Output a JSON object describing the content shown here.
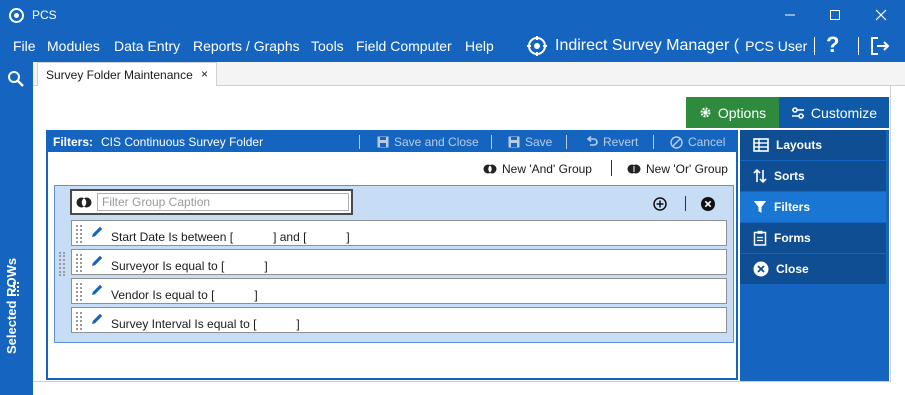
{
  "window": {
    "title": "PCS"
  },
  "menu": {
    "items": [
      "File",
      "Modules",
      "Data Entry",
      "Reports / Graphs",
      "Tools",
      "Field Computer",
      "Help"
    ],
    "app_title": "Indirect Survey Manager (",
    "user": "PCS User",
    "help_icon": "?"
  },
  "sidebar": {
    "label": "Selected ROWs"
  },
  "tabs": [
    {
      "label": "Survey Folder Maintenance",
      "close": "×"
    }
  ],
  "toolbar": {
    "options_label": "Options",
    "customize_label": "Customize"
  },
  "filters_panel": {
    "label": "Filters:",
    "caption": "CIS Continuous Survey Folder",
    "save_close_label": "Save and Close",
    "save_label": "Save",
    "revert_label": "Revert",
    "cancel_label": "Cancel",
    "new_and_group": "New 'And' Group",
    "new_or_group": "New 'Or' Group",
    "group_caption_placeholder": "Filter Group Caption",
    "rows": [
      "Start Date Is between [            ] and [            ]",
      "Surveyor Is equal to [            ]",
      "Vendor Is equal to [            ]",
      "Survey Interval Is equal to [            ]"
    ]
  },
  "side_menu": {
    "items": [
      {
        "label": "Layouts",
        "icon": "layouts-icon",
        "active": false
      },
      {
        "label": "Sorts",
        "icon": "sorts-icon",
        "active": false
      },
      {
        "label": "Filters",
        "icon": "filter-icon",
        "active": true
      },
      {
        "label": "Forms",
        "icon": "forms-icon",
        "active": false
      },
      {
        "label": "Close",
        "icon": "close-circle-icon",
        "active": false
      }
    ]
  },
  "colors": {
    "brand_blue": "#1565c0",
    "options_green": "#2e8b3e",
    "active_side_item": "#1976d2",
    "filter_group_bg": "#c7dcf5"
  }
}
